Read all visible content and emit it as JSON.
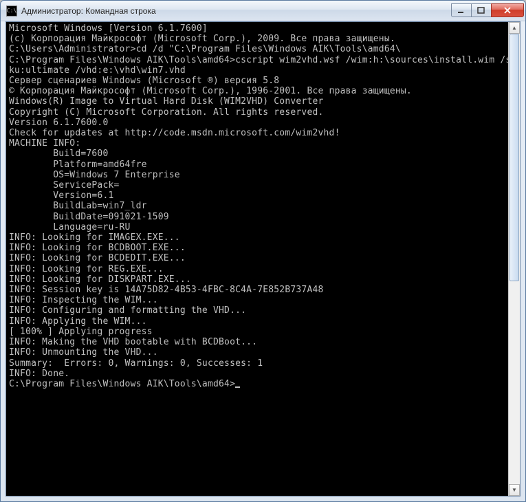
{
  "window": {
    "title": "Администратор: Командная строка",
    "icon_label": "C:\\"
  },
  "terminal": {
    "lines": [
      "Microsoft Windows [Version 6.1.7600]",
      "(c) Корпорация Майкрософт (Microsoft Corp.), 2009. Все права защищены.",
      "",
      "C:\\Users\\Administrator>cd /d \"C:\\Program Files\\Windows AIK\\Tools\\amd64\\",
      "",
      "C:\\Program Files\\Windows AIK\\Tools\\amd64>cscript wim2vhd.wsf /wim:h:\\sources\\install.wim /s",
      "ku:ultimate /vhd:e:\\vhd\\win7.vhd",
      "Сервер сценариев Windows (Microsoft ®) версия 5.8",
      "© Корпорация Майкрософт (Microsoft Corp.), 1996-2001. Все права защищены.",
      "",
      "Windows(R) Image to Virtual Hard Disk (WIM2VHD) Converter",
      "Copyright (C) Microsoft Corporation. All rights reserved.",
      "Version 6.1.7600.0",
      "",
      "Check for updates at http://code.msdn.microsoft.com/wim2vhd!",
      "",
      "MACHINE INFO:",
      "        Build=7600",
      "        Platform=amd64fre",
      "        OS=Windows 7 Enterprise",
      "        ServicePack=",
      "        Version=6.1",
      "        BuildLab=win7_ldr",
      "        BuildDate=091021-1509",
      "        Language=ru-RU",
      "",
      "INFO: Looking for IMAGEX.EXE...",
      "INFO: Looking for BCDBOOT.EXE...",
      "INFO: Looking for BCDEDIT.EXE...",
      "INFO: Looking for REG.EXE...",
      "INFO: Looking for DISKPART.EXE...",
      "INFO: Session key is 14A75D82-4B53-4FBC-8C4A-7E852B737A48",
      "INFO: Inspecting the WIM...",
      "INFO: Configuring and formatting the VHD...",
      "INFO: Applying the WIM...",
      "[ 100% ] Applying progress",
      "INFO: Making the VHD bootable with BCDBoot...",
      "INFO: Unmounting the VHD...",
      "Summary:  Errors: 0, Warnings: 0, Successes: 1",
      "INFO: Done.",
      "",
      "C:\\Program Files\\Windows AIK\\Tools\\amd64>"
    ],
    "cursor_on_last_line": true
  }
}
